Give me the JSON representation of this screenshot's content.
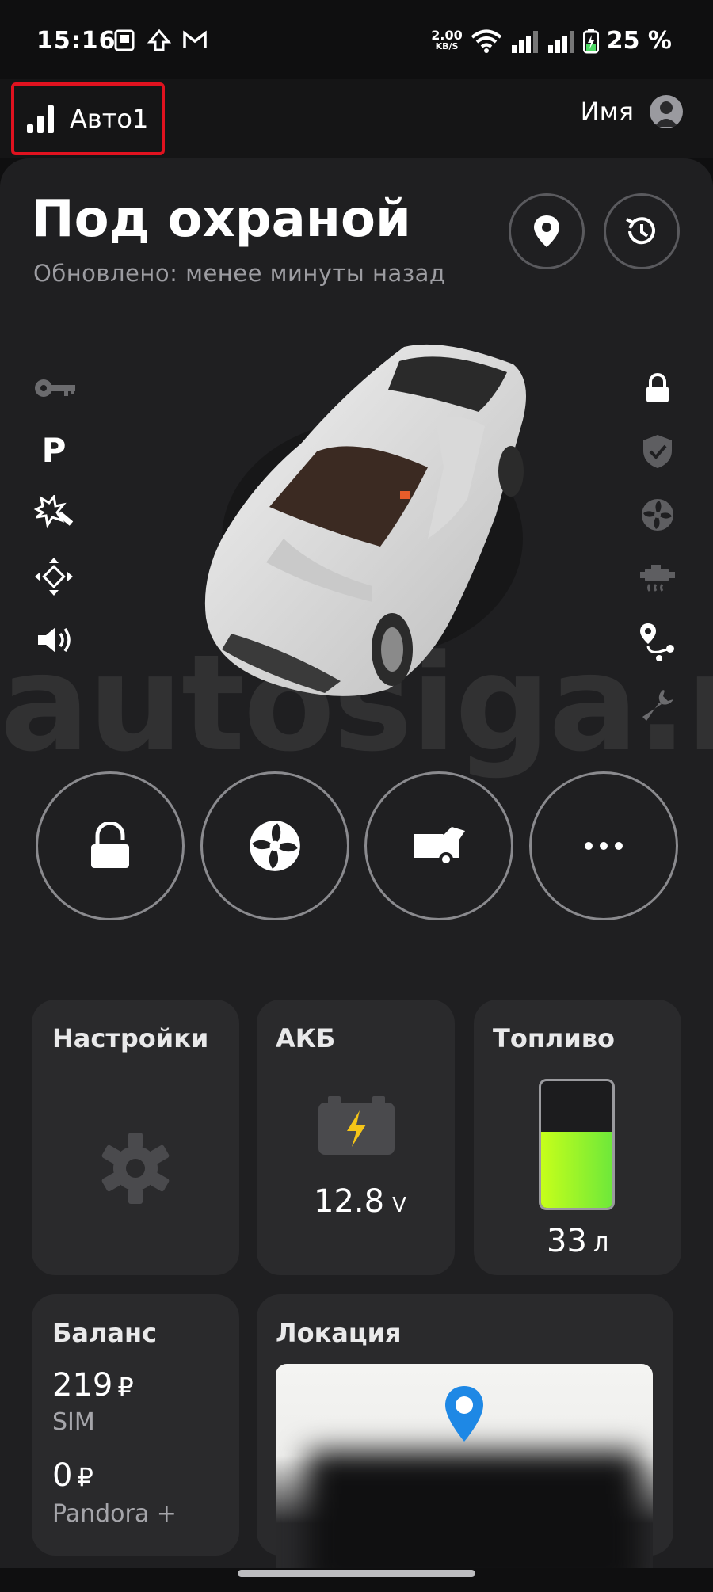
{
  "status_bar": {
    "time": "15:16",
    "net_speed": "2.00",
    "net_unit": "KB/S",
    "battery": "25 %"
  },
  "header": {
    "car_name": "Авто1",
    "user_name": "Имя"
  },
  "main": {
    "title": "Под охраной",
    "updated": "Обновлено: менее минуты назад",
    "watermark": "autosiga.ru"
  },
  "tiles": {
    "settings": {
      "title": "Настройки"
    },
    "battery": {
      "title": "АКБ",
      "value": "12.8",
      "unit": "V"
    },
    "fuel": {
      "title": "Топливо",
      "value": "33",
      "unit": "Л",
      "level": 0.6
    },
    "balance": {
      "title": "Баланс",
      "sim_value": "219",
      "sim_currency": "₽",
      "sim_label": "SIM",
      "pandora_value": "0",
      "pandora_currency": "₽",
      "pandora_label": "Pandora +"
    },
    "location": {
      "title": "Локация"
    }
  },
  "colors": {
    "accent_red": "#e0121f",
    "battery_bolt": "#f5c518",
    "fuel_green": "#7cf03a",
    "map_pin": "#1e88e5"
  }
}
